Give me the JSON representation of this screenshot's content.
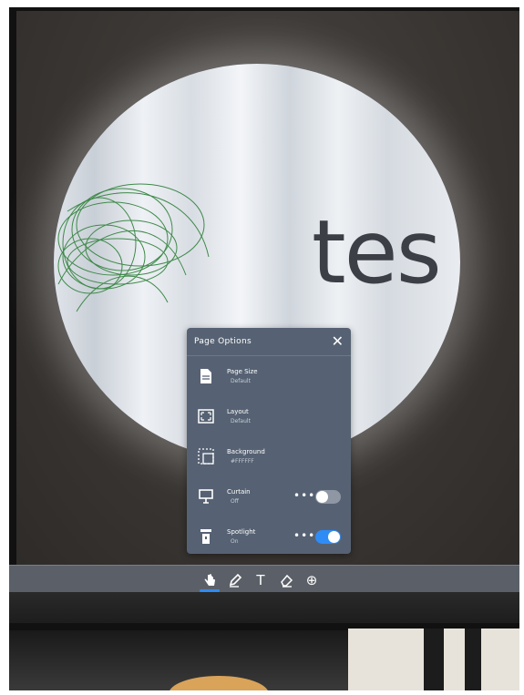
{
  "canvas": {
    "text": "tes"
  },
  "page_options": {
    "title": "Page Options",
    "items": [
      {
        "label": "Page Size",
        "value": "Default",
        "icon": "document-icon"
      },
      {
        "label": "Layout",
        "value": "Default",
        "icon": "layout-icon"
      },
      {
        "label": "Background",
        "value": "#FFFFFF",
        "icon": "background-icon"
      },
      {
        "label": "Curtain",
        "value": "Off",
        "icon": "curtain-icon",
        "more": "•••",
        "toggle": "off"
      },
      {
        "label": "Spotlight",
        "value": "On",
        "icon": "spotlight-icon",
        "more": "•••",
        "toggle": "on"
      }
    ]
  },
  "toolbar": {
    "tools": [
      "select-hand-icon",
      "pen-icon",
      "text-icon",
      "eraser-icon",
      "add-icon"
    ],
    "text_glyph": "T",
    "add_glyph": "⊕"
  },
  "colors": {
    "panel_bg": "#566273",
    "toggle_on": "#2f8cf5",
    "toggle_off": "#8e97a3",
    "ink_green": "#3f8a4a"
  }
}
